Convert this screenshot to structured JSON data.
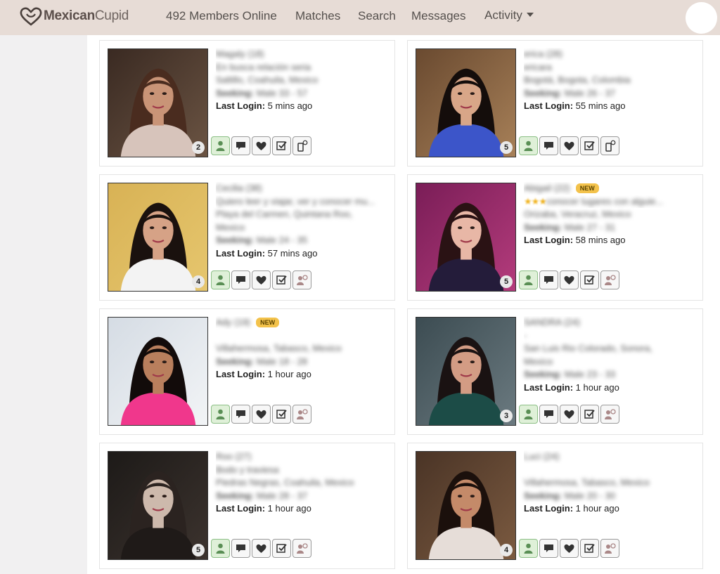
{
  "nav": {
    "logo_bold": "Mexican",
    "logo_light": "Cupid",
    "members_online": "492 Members Online",
    "matches": "Matches",
    "search": "Search",
    "messages": "Messages",
    "activity": "Activity"
  },
  "cards": [
    {
      "name": "Magaly (18)",
      "tagline": "En busca relación seria",
      "location": "Saltillo, Coahuila, Mexico",
      "loc2": "",
      "seeking_label": "Seeking:",
      "seeking": "Male 33 - 57",
      "last_login_label": "Last Login:",
      "last_login": "5 mins ago",
      "photo_count": "2",
      "is_new": false,
      "stars": ""
    },
    {
      "name": "erica (28)",
      "tagline": "ericara",
      "location": "Bogotá, Bogota, Colombia",
      "loc2": "",
      "seeking_label": "Seeking:",
      "seeking": "Male 26 - 37",
      "last_login_label": "Last Login:",
      "last_login": "55 mins ago",
      "photo_count": "5",
      "is_new": false,
      "stars": ""
    },
    {
      "name": "Cecilia (38)",
      "tagline": "Quiero leer y viajar, ver y conocer mu...",
      "location": "Playa del Carmen, Quintana Roo,",
      "loc2": "Mexico",
      "seeking_label": "Seeking:",
      "seeking": "Male 24 - 35",
      "last_login_label": "Last Login:",
      "last_login": "57 mins ago",
      "photo_count": "4",
      "is_new": false,
      "stars": ""
    },
    {
      "name": "Abigail (22)",
      "tagline": "conocer lugares con alguie...",
      "location": "Orizaba, Veracruz, Mexico",
      "loc2": "",
      "seeking_label": "Seeking:",
      "seeking": "Male 27 - 31",
      "last_login_label": "Last Login:",
      "last_login": "58 mins ago",
      "photo_count": "5",
      "is_new": true,
      "new_label": "NEW",
      "stars": "★★★"
    },
    {
      "name": "Ady (19)",
      "tagline": "",
      "location": "Villahermosa, Tabasco, Mexico",
      "loc2": "",
      "seeking_label": "Seeking:",
      "seeking": "Male 18 - 28",
      "last_login_label": "Last Login:",
      "last_login": "1 hour ago",
      "photo_count": "",
      "is_new": true,
      "new_label": "NEW",
      "stars": ""
    },
    {
      "name": "SANDRA (24)",
      "tagline": "-",
      "location": "San Luis Rio Colorado, Sonora,",
      "loc2": "Mexico",
      "seeking_label": "Seeking:",
      "seeking": "Male 23 - 33",
      "last_login_label": "Last Login:",
      "last_login": "1 hour ago",
      "photo_count": "3",
      "is_new": false,
      "stars": ""
    },
    {
      "name": "Roo (27)",
      "tagline": "Bodo y traviesa",
      "location": "Piedras Negras, Coahuila, Mexico",
      "loc2": "",
      "seeking_label": "Seeking:",
      "seeking": "Male 28 - 37",
      "last_login_label": "Last Login:",
      "last_login": "1 hour ago",
      "photo_count": "5",
      "is_new": false,
      "stars": ""
    },
    {
      "name": "Luci (24)",
      "tagline": "",
      "location": "Villahermosa, Tabasco, Mexico",
      "loc2": "",
      "seeking_label": "Seeking:",
      "seeking": "Male 20 - 30",
      "last_login_label": "Last Login:",
      "last_login": "1 hour ago",
      "photo_count": "4",
      "is_new": false,
      "stars": ""
    }
  ],
  "colors": {
    "topbar": "#e7dcd6",
    "accent_green": "#dff0d8",
    "new_badge": "#f3c24b"
  },
  "icons": [
    "heart-logo-icon",
    "caret-down-icon",
    "profile-icon",
    "message-icon",
    "heart-icon",
    "checkbox-icon",
    "mobile-icon"
  ]
}
